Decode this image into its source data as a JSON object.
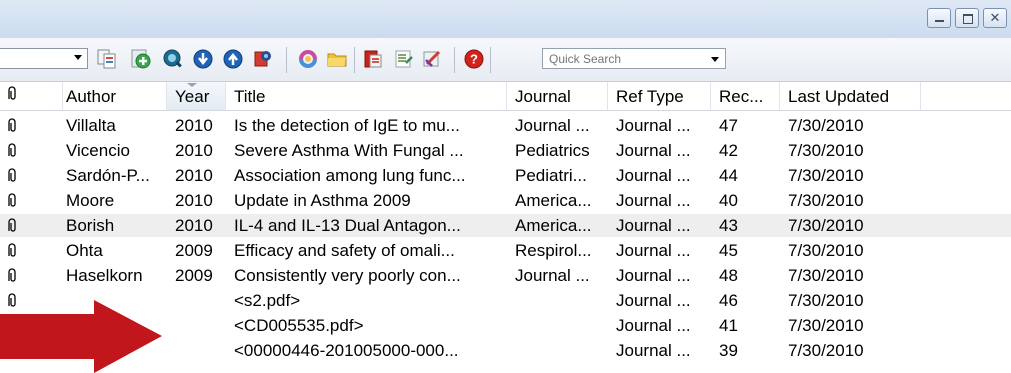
{
  "window": {
    "buttons": [
      {
        "name": "minimize",
        "icon": "minimize-icon"
      },
      {
        "name": "maximize",
        "icon": "maximize-icon"
      },
      {
        "name": "close",
        "icon": "close-icon",
        "glyph": "✕"
      }
    ]
  },
  "toolbar": {
    "style_dropdown_value": "",
    "quick_search_placeholder": "Quick Search",
    "icons": [
      "copy-formatted-icon",
      "new-reference-icon",
      "online-search-icon",
      "download-icon",
      "upload-icon",
      "web-sync-icon",
      "find-full-text-icon",
      "open-folder-icon",
      "insert-citation-icon",
      "format-bibliography-icon",
      "edit-style-icon",
      "help-icon"
    ]
  },
  "columns": [
    {
      "label": "",
      "icon": "paperclip-icon"
    },
    {
      "label": "Author"
    },
    {
      "label": "Year",
      "sorted": true
    },
    {
      "label": "Title"
    },
    {
      "label": "Journal"
    },
    {
      "label": "Ref Type"
    },
    {
      "label": "Rec..."
    },
    {
      "label": "Last Updated"
    }
  ],
  "rows": [
    {
      "attachment": true,
      "author": "Villalta",
      "year": "2010",
      "title": "Is the detection of IgE to mu...",
      "journal": "Journal ...",
      "ref_type": "Journal ...",
      "rec": "47",
      "updated": "7/30/2010",
      "selected": false
    },
    {
      "attachment": true,
      "author": "Vicencio",
      "year": "2010",
      "title": "Severe Asthma With Fungal ...",
      "journal": "Pediatrics",
      "ref_type": "Journal ...",
      "rec": "42",
      "updated": "7/30/2010",
      "selected": false
    },
    {
      "attachment": true,
      "author": "Sardón-P...",
      "year": "2010",
      "title": "Association among lung func...",
      "journal": "Pediatri...",
      "ref_type": "Journal ...",
      "rec": "44",
      "updated": "7/30/2010",
      "selected": false
    },
    {
      "attachment": true,
      "author": "Moore",
      "year": "2010",
      "title": "Update in Asthma 2009",
      "journal": "America...",
      "ref_type": "Journal ...",
      "rec": "40",
      "updated": "7/30/2010",
      "selected": false
    },
    {
      "attachment": true,
      "author": "Borish",
      "year": "2010",
      "title": "IL-4 and IL-13 Dual Antagon...",
      "journal": "America...",
      "ref_type": "Journal ...",
      "rec": "43",
      "updated": "7/30/2010",
      "selected": true
    },
    {
      "attachment": true,
      "author": "Ohta",
      "year": "2009",
      "title": "Efficacy and safety of omali...",
      "journal": "Respirol...",
      "ref_type": "Journal ...",
      "rec": "45",
      "updated": "7/30/2010",
      "selected": false
    },
    {
      "attachment": true,
      "author": "Haselkorn",
      "year": "2009",
      "title": "Consistently very poorly con...",
      "journal": "Journal ...",
      "ref_type": "Journal ...",
      "rec": "48",
      "updated": "7/30/2010",
      "selected": false
    },
    {
      "attachment": true,
      "author": "",
      "year": "",
      "title": "<s2.pdf>",
      "journal": "",
      "ref_type": "Journal ...",
      "rec": "46",
      "updated": "7/30/2010",
      "selected": false
    },
    {
      "attachment": false,
      "author": "",
      "year": "",
      "title": "<CD005535.pdf>",
      "journal": "",
      "ref_type": "Journal ...",
      "rec": "41",
      "updated": "7/30/2010",
      "selected": false
    },
    {
      "attachment": true,
      "author": "",
      "year": "",
      "title": "<00000446-201005000-000...",
      "journal": "",
      "ref_type": "Journal ...",
      "rec": "39",
      "updated": "7/30/2010",
      "selected": false
    }
  ],
  "annotation": {
    "icon": "red-arrow-icon",
    "color": "#c0161c"
  },
  "colors": {
    "selected_row": "#eeeeee",
    "titlebar": "#cbdbee",
    "arrow": "#c0161c"
  }
}
